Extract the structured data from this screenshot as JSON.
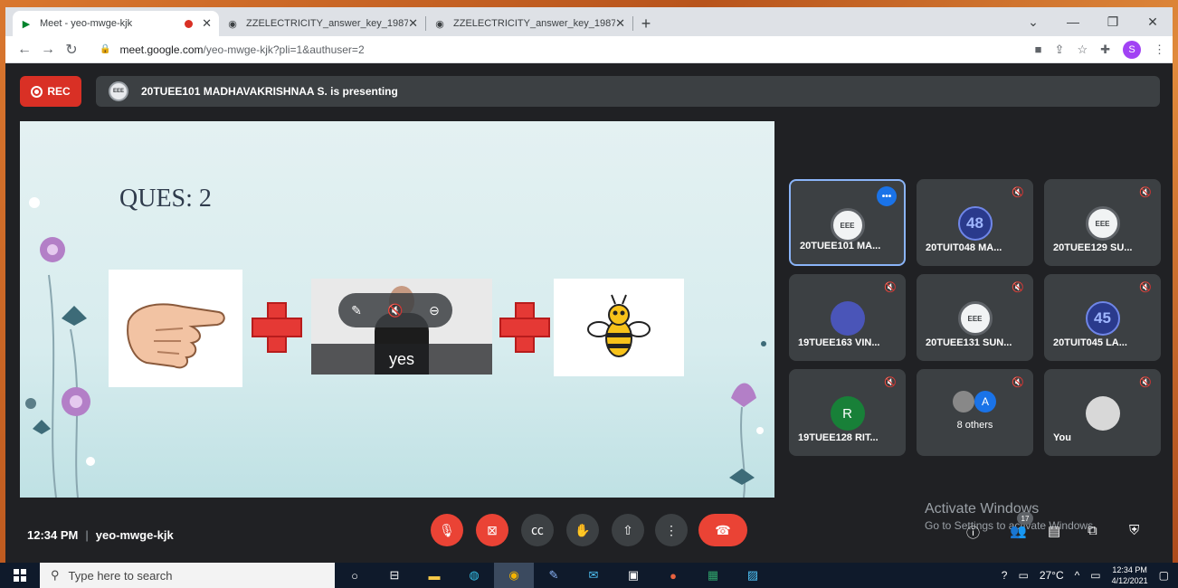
{
  "browser": {
    "tabs": [
      {
        "title": "Meet - yeo-mwge-kjk",
        "icon": "meet-icon"
      },
      {
        "title": "ZZELECTRICITY_answer_key_1987",
        "icon": "globe-icon"
      },
      {
        "title": "ZZELECTRICITY_answer_key_1987",
        "icon": "globe-icon"
      }
    ],
    "url_host": "meet.google.com",
    "url_path": "/yeo-mwge-kjk?pli=1&authuser=2",
    "profile_initial": "S"
  },
  "meet": {
    "rec_label": "REC",
    "presenting_text": "20TUEE101 MADHAVAKRISHNAA S. is presenting",
    "presenter_avatar": "EEE",
    "slide": {
      "title": "QUES: 2",
      "video_caption": "yes"
    },
    "participants": [
      {
        "name": "20TUEE101 MA...",
        "avatar": "EEE",
        "type": "eee",
        "active": true
      },
      {
        "name": "20TUIT048 MA...",
        "avatar": "48",
        "type": "num"
      },
      {
        "name": "20TUEE129 SU...",
        "avatar": "EEE",
        "type": "eee"
      },
      {
        "name": "19TUEE163 VIN...",
        "avatar": "",
        "type": "cat"
      },
      {
        "name": "20TUEE131 SUN...",
        "avatar": "EEE",
        "type": "eee"
      },
      {
        "name": "20TUIT045 LA...",
        "avatar": "45",
        "type": "num"
      },
      {
        "name": "19TUEE128 RIT...",
        "avatar": "R",
        "type": "r"
      },
      {
        "name": "8 others",
        "avatar": "A",
        "type": "others"
      },
      {
        "name": "You",
        "avatar": "",
        "type": "you"
      }
    ],
    "time": "12:34 PM",
    "meeting_code": "yeo-mwge-kjk",
    "people_count": "17",
    "activate_title": "Activate Windows",
    "activate_sub": "Go to Settings to activate Windows."
  },
  "taskbar": {
    "search_placeholder": "Type here to search",
    "weather": "27°C",
    "clock_time": "12:34 PM",
    "clock_date": "4/12/2021"
  }
}
